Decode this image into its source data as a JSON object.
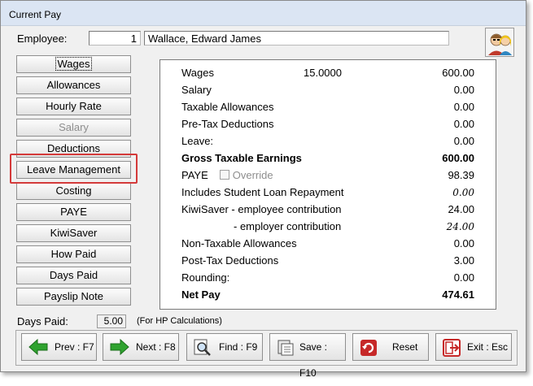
{
  "window": {
    "title": "Current Pay"
  },
  "employee": {
    "label": "Employee:",
    "number": "1",
    "name": "Wallace, Edward James"
  },
  "nav": [
    {
      "key": "wages",
      "label": "Wages",
      "disabled": false,
      "focused": true
    },
    {
      "key": "allowances",
      "label": "Allowances",
      "disabled": false
    },
    {
      "key": "hourly-rate",
      "label": "Hourly Rate",
      "disabled": false
    },
    {
      "key": "salary",
      "label": "Salary",
      "disabled": true
    },
    {
      "key": "deductions",
      "label": "Deductions",
      "disabled": false
    },
    {
      "key": "leave-management",
      "label": "Leave Management",
      "disabled": false
    },
    {
      "key": "costing",
      "label": "Costing",
      "disabled": false
    },
    {
      "key": "paye",
      "label": "PAYE",
      "disabled": false
    },
    {
      "key": "kiwisaver",
      "label": "KiwiSaver",
      "disabled": false
    },
    {
      "key": "how-paid",
      "label": "How Paid",
      "disabled": false
    },
    {
      "key": "days-paid",
      "label": "Days Paid",
      "disabled": false
    },
    {
      "key": "payslip-note",
      "label": "Payslip Note",
      "disabled": false
    }
  ],
  "summary": {
    "wages": {
      "label": "Wages",
      "rate": "15.0000",
      "value": "600.00"
    },
    "salary": {
      "label": "Salary",
      "value": "0.00"
    },
    "taxable_allowances": {
      "label": "Taxable Allowances",
      "value": "0.00"
    },
    "pretax": {
      "label": "Pre-Tax Deductions",
      "value": "0.00"
    },
    "leave": {
      "label": "Leave:",
      "value": "0.00"
    },
    "gross": {
      "label": "Gross Taxable Earnings",
      "value": "600.00"
    },
    "paye": {
      "label": "PAYE",
      "override_label": "Override",
      "value": "98.39"
    },
    "student_loan": {
      "label": "Includes Student Loan Repayment",
      "value": "0.00"
    },
    "kiwi_emp": {
      "label": "KiwiSaver - employee contribution",
      "value": "24.00"
    },
    "kiwi_empr": {
      "label": "- employer contribution",
      "value": "24.00"
    },
    "nontax": {
      "label": "Non-Taxable Allowances",
      "value": "0.00"
    },
    "posttax": {
      "label": "Post-Tax Deductions",
      "value": "3.00"
    },
    "rounding": {
      "label": "Rounding:",
      "value": "0.00"
    },
    "net": {
      "label": "Net Pay",
      "value": "474.61"
    }
  },
  "days_paid": {
    "label": "Days Paid:",
    "value": "5.00",
    "note": "(For HP Calculations)"
  },
  "actions": {
    "prev": "Prev : F7",
    "next": "Next : F8",
    "find": "Find : F9",
    "save": "Save : F10",
    "reset": "Reset",
    "exit": "Exit : Esc"
  },
  "colors": {
    "highlight": "#d43a3a",
    "arrow_green": "#2fa32f",
    "reset_red": "#c62828"
  }
}
